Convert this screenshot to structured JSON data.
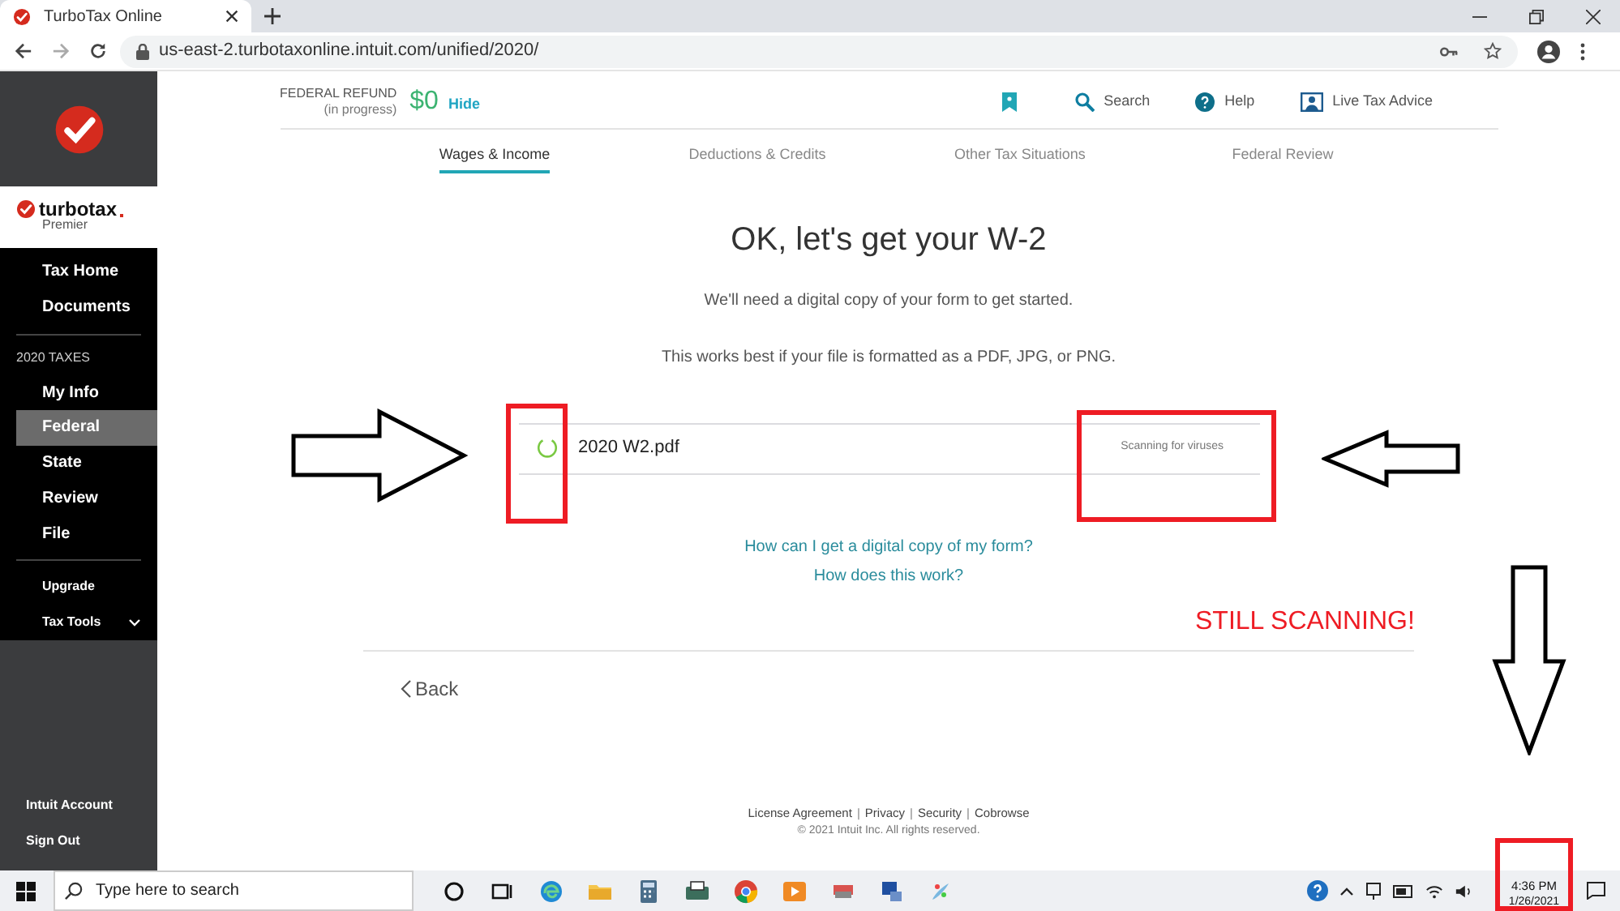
{
  "browser": {
    "tab_title": "TurboTax Online",
    "url": "us-east-2.turbotaxonline.intuit.com/unified/2020/"
  },
  "sidebar": {
    "brand": "turbotax",
    "edition": "Premier",
    "items": [
      {
        "kind": "link",
        "label": "Tax Home",
        "selected": false
      },
      {
        "kind": "link",
        "label": "Documents",
        "selected": false
      },
      {
        "kind": "divider"
      },
      {
        "kind": "section",
        "label": "2020 TAXES"
      },
      {
        "kind": "link",
        "label": "My Info",
        "selected": false
      },
      {
        "kind": "link",
        "label": "Federal",
        "selected": true
      },
      {
        "kind": "link",
        "label": "State",
        "selected": false
      },
      {
        "kind": "link",
        "label": "Review",
        "selected": false
      },
      {
        "kind": "link",
        "label": "File",
        "selected": false
      },
      {
        "kind": "divider"
      },
      {
        "kind": "small",
        "label": "Upgrade",
        "selected": false
      },
      {
        "kind": "menu",
        "label": "Tax Tools",
        "selected": false,
        "expanded": false
      }
    ],
    "footer_links": [
      "Intuit Account",
      "Sign Out"
    ]
  },
  "refund": {
    "label": "FEDERAL REFUND",
    "sublabel": "(in progress)",
    "amount": "$0",
    "toggle": "Hide"
  },
  "header_actions": [
    {
      "kind": "bookmark"
    },
    {
      "kind": "search",
      "label": "Search"
    },
    {
      "kind": "help",
      "label": "Help"
    },
    {
      "kind": "advice",
      "label": "Live Tax Advice"
    }
  ],
  "tabs": [
    {
      "label": "Wages & Income",
      "selected": true
    },
    {
      "label": "Deductions & Credits",
      "selected": false
    },
    {
      "label": "Other Tax Situations",
      "selected": false
    },
    {
      "label": "Federal Review",
      "selected": false
    }
  ],
  "title": "OK, let's get your W-2",
  "paragraphs": [
    "We'll need a digital copy of your form to get started.",
    "This works best if your file is formatted as a PDF, JPG, or PNG."
  ],
  "file": {
    "name": "2020 W2.pdf",
    "status": "Scanning for viruses",
    "loading": true
  },
  "help_links": [
    "How can I get a digital copy of my form?",
    "How does this work?"
  ],
  "back": "Back",
  "footer": {
    "links": [
      "License Agreement",
      "Privacy",
      "Security",
      "Cobrowse"
    ],
    "separator": "|",
    "copyright": "© 2021 Intuit Inc. All rights reserved."
  },
  "annotations": [
    {
      "kind": "arrow-right"
    },
    {
      "kind": "box"
    },
    {
      "kind": "box"
    },
    {
      "kind": "arrow-left"
    },
    {
      "kind": "text",
      "text": "STILL SCANNING!"
    },
    {
      "kind": "arrow-down"
    },
    {
      "kind": "box"
    }
  ],
  "taskbar": {
    "search_placeholder": "Type here to search",
    "time": "4:36 PM",
    "date": "1/26/2021"
  }
}
